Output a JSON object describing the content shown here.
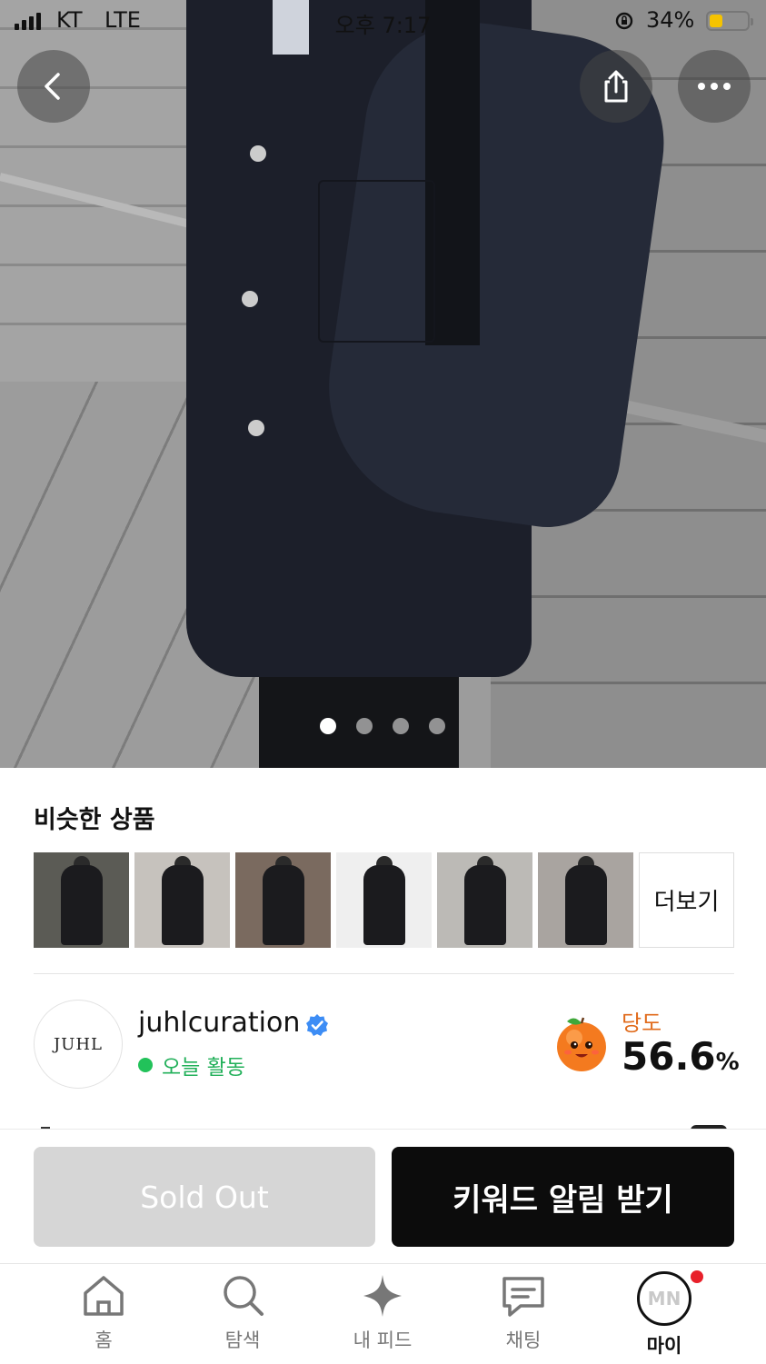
{
  "status_bar": {
    "carrier": "KT",
    "network": "LTE",
    "time": "오후 7:17",
    "battery": "34%"
  },
  "hero": {
    "image_count": 4,
    "active_index": 0
  },
  "icons": {
    "back": "chevron-left-icon",
    "share": "share-icon",
    "more": "more-dots-icon"
  },
  "similar": {
    "title": "비슷한 상품",
    "more_label": "더보기",
    "thumbs": [
      {
        "bg": "#5b5b55"
      },
      {
        "bg": "#c6c2bd"
      },
      {
        "bg": "#7a6a5f"
      },
      {
        "bg": "#efefef"
      },
      {
        "bg": "#bcbab6"
      },
      {
        "bg": "#a9a4a0"
      }
    ]
  },
  "seller": {
    "avatar_text": "JUHL",
    "name": "juhlcuration",
    "activity": "오늘 활동",
    "temperature_label": "당도",
    "temperature_value": "56.6",
    "temperature_unit": "%"
  },
  "actions": {
    "sold_out": "Sold Out",
    "keyword_alert": "키워드 알림 받기"
  },
  "tabbar": {
    "items": [
      {
        "label": "홈"
      },
      {
        "label": "탐색"
      },
      {
        "label": "내 피드"
      },
      {
        "label": "채팅"
      },
      {
        "label": "마이"
      }
    ],
    "profile_initials": "MN"
  },
  "colors": {
    "accent_green": "#22c25a",
    "primary_button": "#0c0c0c",
    "disabled_button": "#d6d6d6",
    "badge_red": "#e8202a"
  }
}
